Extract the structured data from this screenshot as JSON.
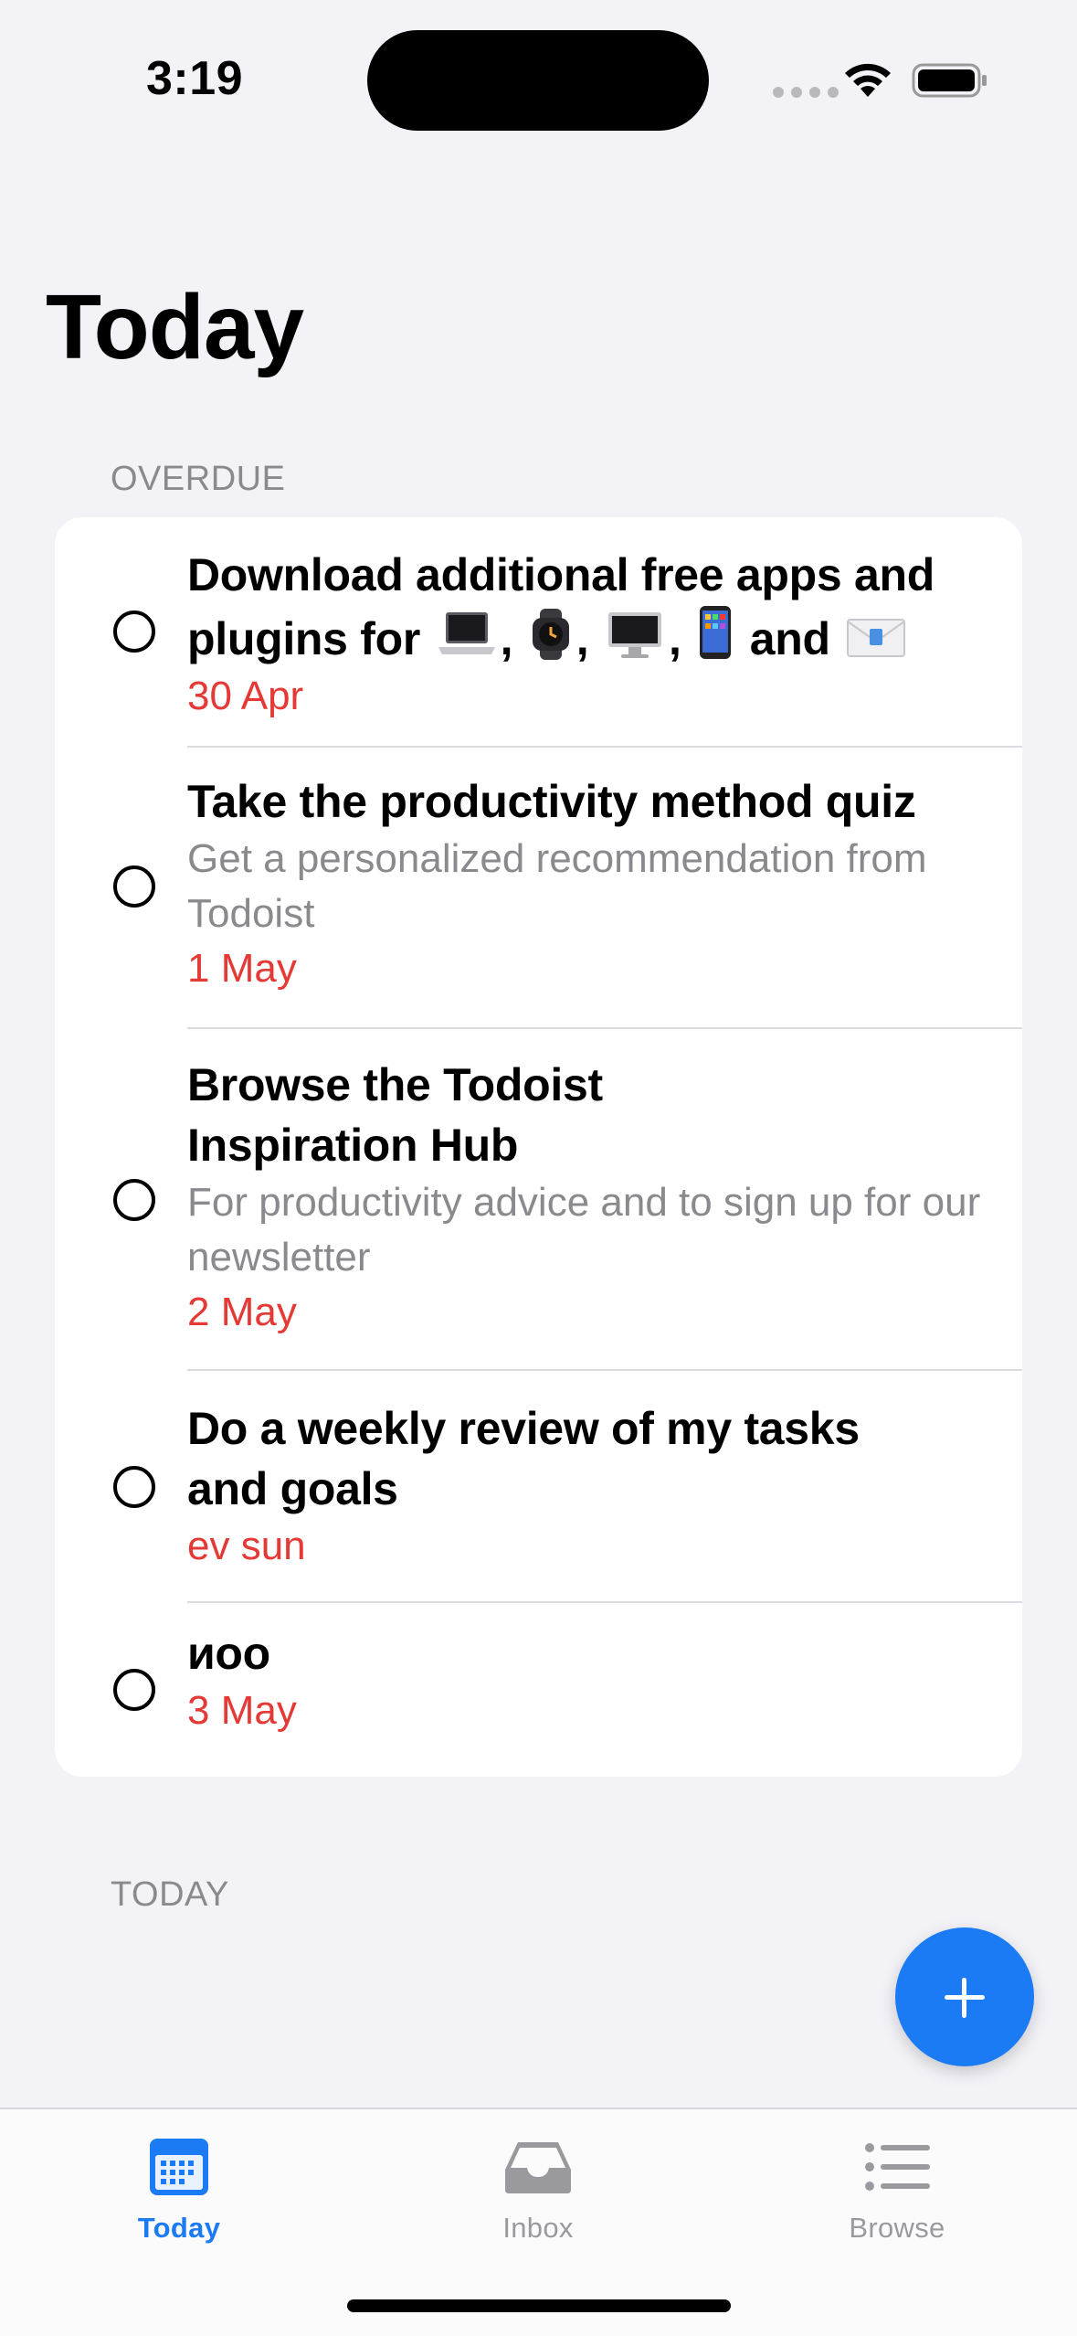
{
  "status_bar": {
    "time": "3:19"
  },
  "page": {
    "title": "Today"
  },
  "sections": {
    "overdue": "OVERDUE",
    "today": "TODAY"
  },
  "tasks": [
    {
      "title_part1": "Download additional free apps and plugins for",
      "title_sep": ",",
      "title_and": "and",
      "emoji_icons": [
        "laptop-icon",
        "watch-icon",
        "desktop-icon",
        "iphone-icon",
        "mail-icon"
      ],
      "date": "30 Apr"
    },
    {
      "title": "Take the productivity method quiz",
      "description": "Get a personalized recommendation from Todoist",
      "date": "1 May"
    },
    {
      "title": "Browse the Todoist Inspiration Hub",
      "description": "For productivity advice and to sign up for our newsletter",
      "date": "2 May"
    },
    {
      "title": "Do a weekly review of my tasks and goals",
      "date": "ev sun"
    },
    {
      "title": "иоо",
      "date": "3 May"
    }
  ],
  "tab_bar": {
    "tabs": [
      {
        "label": "Today",
        "icon": "calendar-icon",
        "active": true
      },
      {
        "label": "Inbox",
        "icon": "inbox-tray-icon",
        "active": false
      },
      {
        "label": "Browse",
        "icon": "list-icon",
        "active": false
      }
    ]
  },
  "colors": {
    "accent": "#1a7bf5",
    "overdue_red": "#e53935",
    "secondary_text": "#8a8a8e",
    "background": "#f2f2f7"
  }
}
